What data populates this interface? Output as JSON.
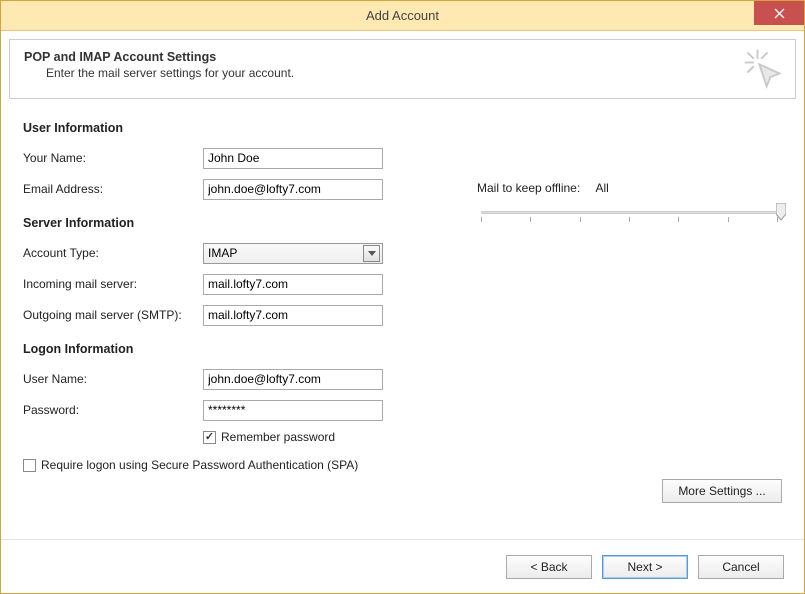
{
  "window": {
    "title": "Add Account"
  },
  "header": {
    "title": "POP and IMAP Account Settings",
    "subtitle": "Enter the mail server settings for your account."
  },
  "sections": {
    "user_info": "User Information",
    "server_info": "Server Information",
    "logon_info": "Logon Information"
  },
  "labels": {
    "your_name": "Your Name:",
    "email": "Email Address:",
    "account_type": "Account Type:",
    "incoming": "Incoming mail server:",
    "outgoing": "Outgoing mail server (SMTP):",
    "user_name": "User Name:",
    "password": "Password:",
    "remember_pw": "Remember password",
    "require_spa": "Require logon using Secure Password Authentication (SPA)",
    "mail_offline": "Mail to keep offline:",
    "offline_value": "All"
  },
  "values": {
    "your_name": "John Doe",
    "email": "john.doe@lofty7.com",
    "account_type": "IMAP",
    "incoming": "mail.lofty7.com",
    "outgoing": "mail.lofty7.com",
    "user_name": "john.doe@lofty7.com",
    "password": "********",
    "remember_pw_checked": true,
    "require_spa_checked": false
  },
  "buttons": {
    "more_settings": "More Settings ...",
    "back": "<  Back",
    "next": "Next  >",
    "cancel": "Cancel"
  }
}
